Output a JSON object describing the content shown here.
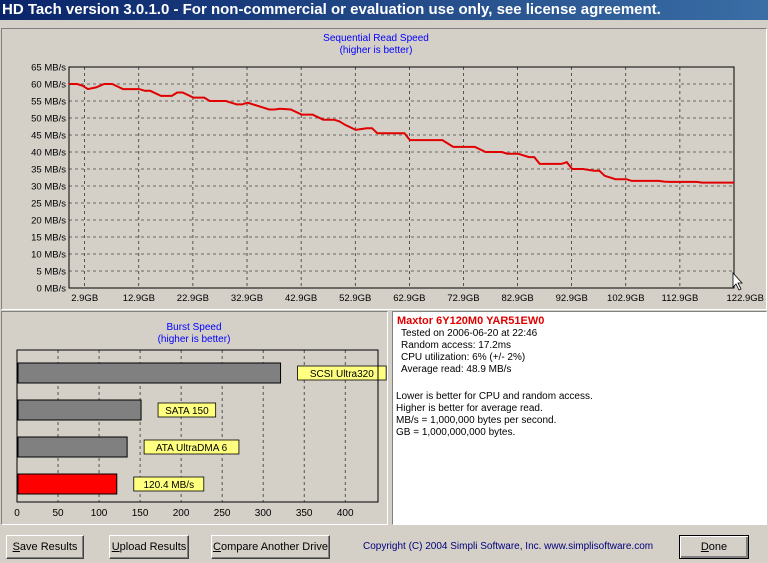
{
  "window": {
    "title": "HD Tach version 3.0.1.0  - For non-commercial or evaluation use only, see license agreement."
  },
  "colors": {
    "read_line": "#e00000",
    "title_text": "#0000ff",
    "burst_bar_current": "#ff0000",
    "burst_bar_reference": "#808080",
    "bar_label_bg": "#ffff80",
    "drive_name": "#e00000"
  },
  "sequential": {
    "chart_data": {
      "type": "line",
      "title": "Sequential Read Speed",
      "subtitle": "(higher is better)",
      "y_ticks": [
        "65 MB/s",
        "60 MB/s",
        "55 MB/s",
        "50 MB/s",
        "45 MB/s",
        "40 MB/s",
        "35 MB/s",
        "30 MB/s",
        "25 MB/s",
        "20 MB/s",
        "15 MB/s",
        "10 MB/s",
        "5 MB/s",
        "0 MB/s"
      ],
      "x_ticks": [
        "2.9GB",
        "12.9GB",
        "22.9GB",
        "32.9GB",
        "42.9GB",
        "52.9GB",
        "62.9GB",
        "72.9GB",
        "82.9GB",
        "92.9GB",
        "102.9GB",
        "112.9GB",
        "122.9GB"
      ],
      "ylim": [
        0,
        65
      ],
      "xlim": [
        0,
        122.9
      ],
      "grid": true,
      "series": [
        {
          "x": [
            0,
            1.5,
            2.5,
            3.5,
            5,
            6.5,
            8,
            10,
            11,
            12,
            13,
            14,
            15,
            17,
            19,
            20,
            21,
            23,
            25,
            26,
            27,
            29,
            31,
            32,
            33,
            35,
            37,
            38,
            39,
            41,
            43,
            44,
            45,
            47,
            49,
            50,
            51,
            53,
            55,
            56,
            57,
            59,
            61,
            62,
            63,
            65,
            67,
            68,
            69,
            71,
            73,
            74,
            75,
            77,
            79,
            80,
            81,
            83,
            85,
            86,
            87,
            89,
            91,
            92,
            93,
            95,
            97,
            98,
            99,
            101,
            103,
            104,
            105,
            107,
            109,
            110,
            111,
            113,
            115,
            116,
            117,
            119,
            121,
            122.9
          ],
          "y": [
            60,
            60,
            59.5,
            58.5,
            59,
            60,
            60,
            58.5,
            58.5,
            58.5,
            58.5,
            58,
            58,
            56.5,
            56.5,
            57.5,
            57.5,
            56,
            56,
            55,
            55,
            55,
            54,
            54,
            54.5,
            53.5,
            52.5,
            52.5,
            52.7,
            52.5,
            51,
            51,
            51,
            49.5,
            49.5,
            49,
            48,
            46.5,
            47,
            47,
            45.5,
            45.5,
            45.5,
            45.5,
            43.5,
            43.5,
            43.5,
            43.5,
            43.5,
            41.5,
            41.5,
            41.5,
            41.5,
            40,
            40,
            40,
            39.5,
            39.5,
            38.5,
            38.5,
            36.5,
            36.5,
            36.5,
            37,
            35,
            35,
            34.5,
            34.5,
            33,
            32,
            32,
            31.5,
            31.5,
            31.5,
            31.5,
            31.3,
            31.2,
            31.2,
            31.2,
            31.2,
            31,
            31,
            31,
            31
          ]
        }
      ]
    }
  },
  "burst": {
    "chart_data": {
      "type": "bar",
      "title": "Burst Speed",
      "subtitle": "(higher is better)",
      "categories": [
        "SCSI Ultra320",
        "SATA 150",
        "ATA UltraDMA 6",
        "120.4 MB/s"
      ],
      "values": [
        320,
        150,
        133,
        120.4
      ],
      "x_ticks": [
        "0",
        "50",
        "100",
        "150",
        "200",
        "250",
        "300",
        "350",
        "400"
      ],
      "xlim": [
        0,
        440
      ],
      "grid": true
    }
  },
  "info": {
    "drive_name": "Maxtor 6Y120M0 YAR51EW0",
    "tested_on": "Tested on 2006-06-20 at 22:46",
    "random_access": "Random access: 17.2ms",
    "cpu_util": "CPU utilization: 6% (+/- 2%)",
    "avg_read": "Average read: 48.9 MB/s",
    "note1": "Lower is better for CPU and random access.",
    "note2": "Higher is better for average read.",
    "note3": "MB/s = 1,000,000 bytes per second.",
    "note4": "GB = 1,000,000,000 bytes."
  },
  "buttons": {
    "save_ul": "S",
    "save_rest": "ave Results",
    "upload_ul": "U",
    "upload_rest": "pload Results",
    "compare_ul": "C",
    "compare_rest": "ompare Another Drive",
    "done_ul": "D",
    "done_rest": "one"
  },
  "footer": {
    "copyright": "Copyright (C) 2004 Simpli Software, Inc. www.simplisoftware.com"
  },
  "cursor": {
    "icon": "mouse-pointer-icon"
  }
}
